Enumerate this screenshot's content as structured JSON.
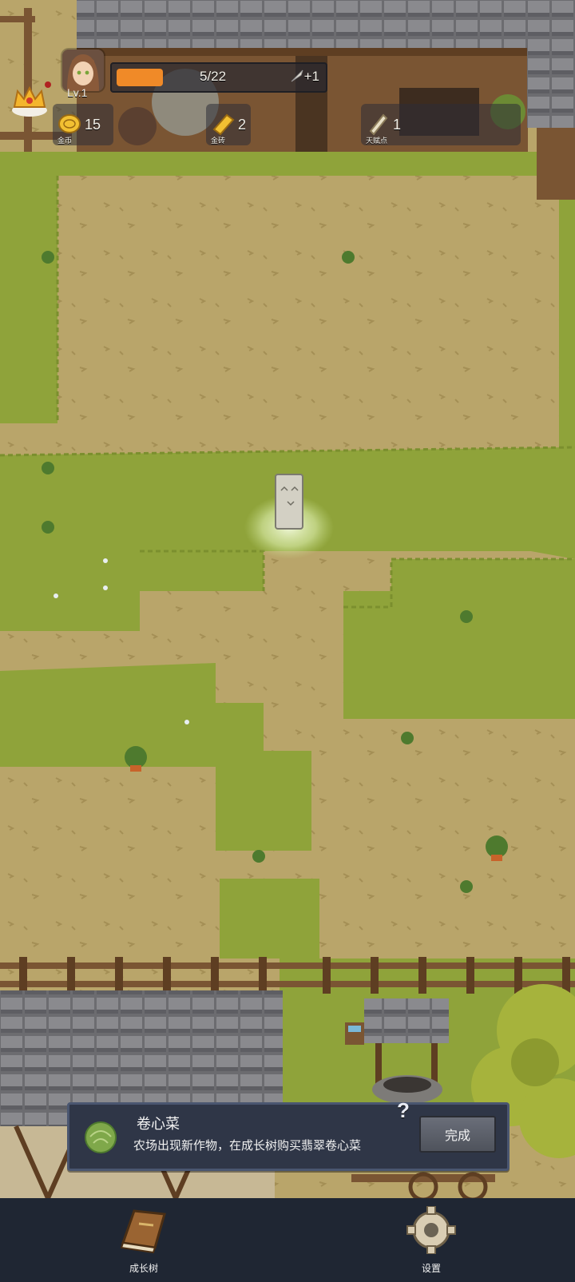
{
  "player": {
    "level_label": "Lv.1",
    "xp_text": "5/22",
    "xp_fraction": 0.227,
    "xp_bonus": "+1"
  },
  "resources": [
    {
      "name": "gold",
      "label": "金币",
      "value": "15",
      "icon": "gold-coin-icon"
    },
    {
      "name": "gold-brick",
      "label": "金砖",
      "value": "2",
      "icon": "gold-bar-icon"
    },
    {
      "name": "talent",
      "label": "天赋点",
      "value": "1",
      "icon": "scroll-icon"
    }
  ],
  "notification": {
    "title": "卷心菜",
    "description": "农场出现新作物，在成长树购买翡翠卷心菜",
    "help_glyph": "?",
    "button_label": "完成",
    "icon": "cabbage-icon"
  },
  "nav": {
    "growth_tree_label": "成长树",
    "settings_label": "设置"
  },
  "colors": {
    "xp_fill": "#f08a28",
    "panel_bg": "#2f3647",
    "bottom_bar": "#1f2633",
    "dirt": "#b9a56a",
    "grass": "#8fa33a"
  }
}
